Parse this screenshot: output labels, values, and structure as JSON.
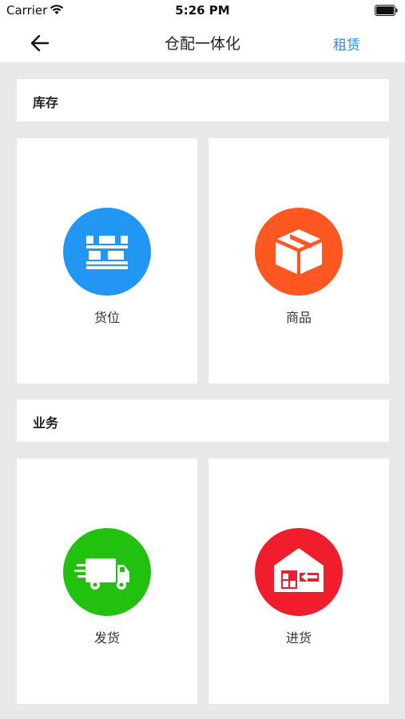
{
  "status_bar": {
    "carrier": "Carrier",
    "time": "5:26 PM",
    "wifi_icon": "wifi-icon",
    "battery_icon": "battery-icon"
  },
  "nav": {
    "back_icon": "arrow-left-icon",
    "title": "仓配一体化",
    "right_action": "租赁"
  },
  "sections": [
    {
      "title": "库存",
      "items": [
        {
          "label": "货位",
          "icon": "shelf-icon",
          "color": "#2196f3"
        },
        {
          "label": "商品",
          "icon": "box-icon",
          "color": "#ff5722"
        }
      ]
    },
    {
      "title": "业务",
      "items": [
        {
          "label": "发货",
          "icon": "truck-icon",
          "color": "#22c10f"
        },
        {
          "label": "进货",
          "icon": "warehouse-inbound-icon",
          "color": "#f01e2c"
        }
      ]
    }
  ],
  "colors": {
    "accent": "#2b8ae6",
    "background": "#e8e8e8",
    "card": "#ffffff"
  }
}
